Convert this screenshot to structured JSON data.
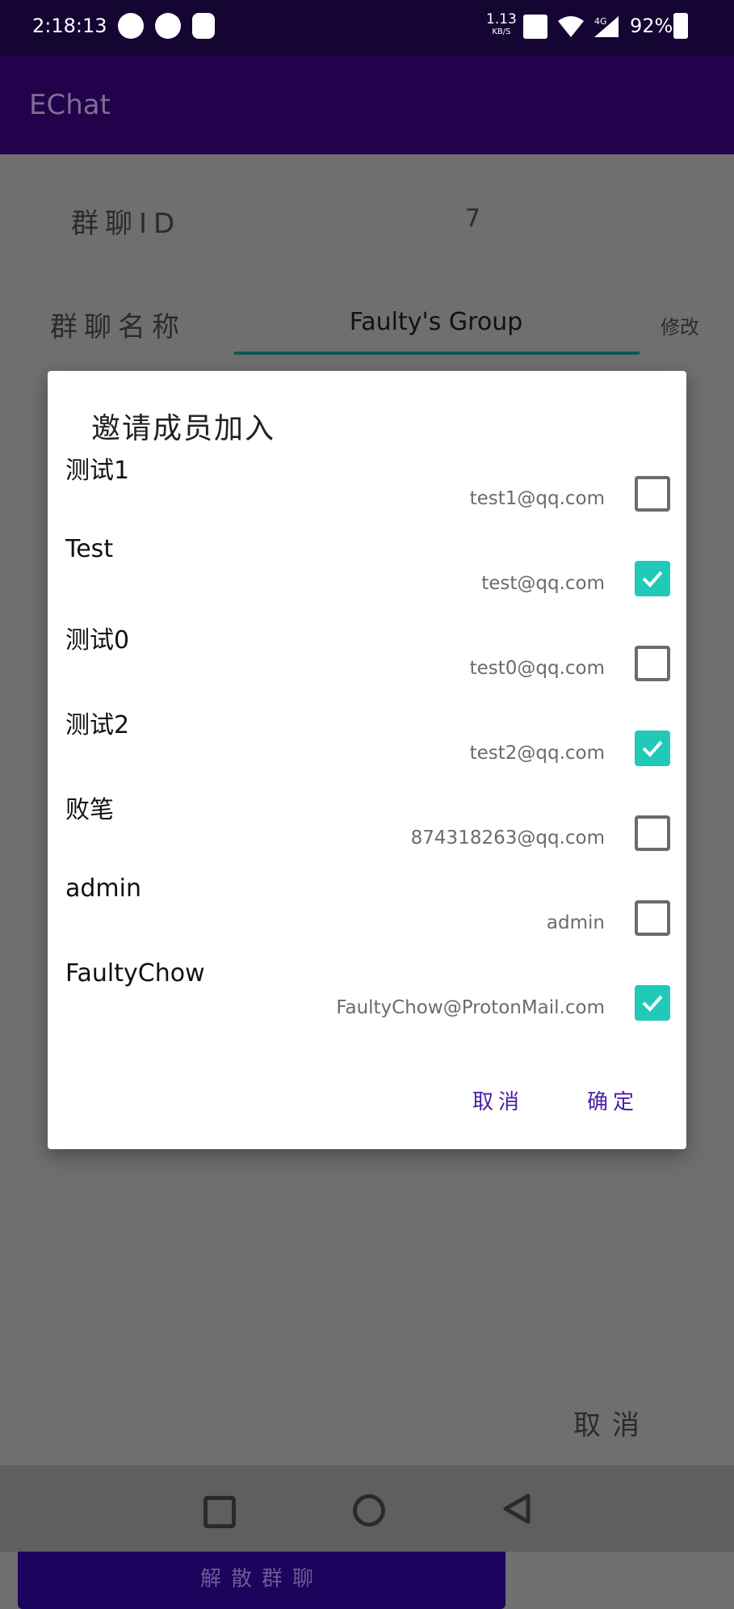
{
  "status_bar": {
    "time": "2:18:13",
    "net_speed": "1.13",
    "net_speed_unit": "KB/S",
    "network_type": "4G",
    "battery": "92%"
  },
  "app_bar": {
    "title": "EChat"
  },
  "background": {
    "group_id_label": "群聊ID",
    "group_id_value": "7",
    "group_name_label": "群聊名称",
    "group_name_value": "Faulty's Group",
    "modify_label": "修改",
    "dissolve_label": "解散群聊",
    "cancel_label": "取消"
  },
  "dialog": {
    "title": "邀请成员加入",
    "members": [
      {
        "name": "测试1",
        "email": "test1@qq.com",
        "checked": false
      },
      {
        "name": "Test",
        "email": "test@qq.com",
        "checked": true
      },
      {
        "name": "测试0",
        "email": "test0@qq.com",
        "checked": false
      },
      {
        "name": "测试2",
        "email": "test2@qq.com",
        "checked": true
      },
      {
        "name": "败笔",
        "email": "874318263@qq.com",
        "checked": false
      },
      {
        "name": "admin",
        "email": "admin",
        "checked": false
      },
      {
        "name": "FaultyChow",
        "email": "FaultyChow@ProtonMail.com",
        "checked": true
      }
    ],
    "cancel_label": "取消",
    "ok_label": "确定"
  },
  "colors": {
    "accent": "#21c9b9",
    "app_bar": "#22024b",
    "primary_button": "#1c035d"
  }
}
